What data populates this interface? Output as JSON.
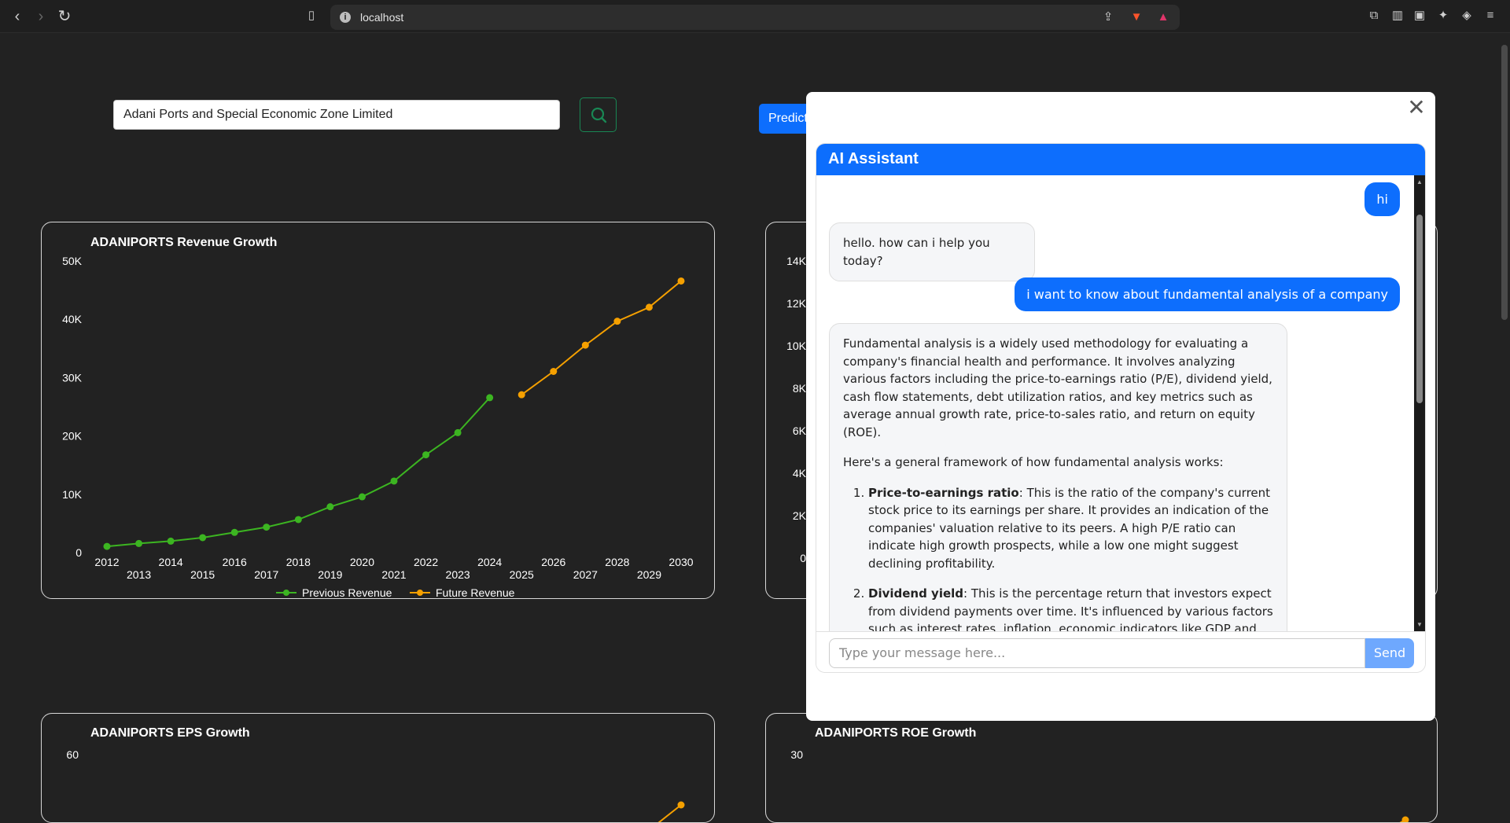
{
  "browser": {
    "url": "localhost",
    "icons": [
      "back-icon",
      "forward-icon",
      "reload-icon",
      "bookmark-icon",
      "site-info-icon",
      "share-icon",
      "brave-shields-icon",
      "rewards-icon",
      "extensions-icon",
      "sidebar-icon",
      "wallet-icon",
      "leo-icon",
      "vpn-icon",
      "menu-icon"
    ]
  },
  "search": {
    "value": "Adani Ports and Special Economic Zone Limited"
  },
  "predict_label": "Predict",
  "charts": {
    "revenue_title": "ADANIPORTS Revenue Growth",
    "eps_title": "ADANIPORTS EPS Growth",
    "roe_title": "ADANIPORTS ROE Growth",
    "second_chart_ticks": [
      "14K",
      "12K",
      "10K",
      "8K",
      "6K",
      "4K",
      "2K",
      "0"
    ]
  },
  "chart_data": [
    {
      "type": "line",
      "title": "ADANIPORTS Revenue Growth",
      "x": [
        2012,
        2013,
        2014,
        2015,
        2016,
        2017,
        2018,
        2019,
        2020,
        2021,
        2022,
        2023,
        2024,
        2025,
        2026,
        2027,
        2028,
        2029,
        2030
      ],
      "series": [
        {
          "name": "Previous Revenue",
          "color": "#3cb521",
          "x": [
            2012,
            2013,
            2014,
            2015,
            2016,
            2017,
            2018,
            2019,
            2020,
            2021,
            2022,
            2023,
            2024
          ],
          "values": [
            1200,
            1700,
            2100,
            2700,
            3600,
            4500,
            5800,
            8000,
            9700,
            12400,
            16900,
            20700,
            26700
          ]
        },
        {
          "name": "Future Revenue",
          "color": "#f5a000",
          "x": [
            2025,
            2026,
            2027,
            2028,
            2029,
            2030
          ],
          "values": [
            27200,
            31200,
            35700,
            39800,
            42200,
            46700
          ]
        }
      ],
      "y_ticks": [
        "0",
        "10K",
        "20K",
        "30K",
        "40K",
        "50K"
      ],
      "ylim": [
        0,
        50000
      ],
      "grid": false,
      "legend": "bottom"
    },
    {
      "type": "line",
      "title": "ADANIPORTS EPS Growth",
      "y_ticks": [
        "60"
      ]
    },
    {
      "type": "line",
      "title": "ADANIPORTS ROE Growth",
      "y_ticks": [
        "30"
      ]
    }
  ],
  "modal": {
    "close_icon": "close-icon",
    "chat_title": "AI Assistant",
    "messages": {
      "user1": "hi",
      "bot1": "hello. how can i help you today?",
      "user2": "i want to know about fundamental analysis of a company",
      "bot2_p1": "Fundamental analysis is a widely used methodology for evaluating a company's financial health and performance. It involves analyzing various factors including the price-to-earnings ratio (P/E), dividend yield, cash flow statements, debt utilization ratios, and key metrics such as average annual growth rate, price-to-sales ratio, and return on equity (ROE).",
      "bot2_p2": "Here's a general framework of how fundamental analysis works:",
      "bot2_item1_head": "Price-to-earnings ratio",
      "bot2_item1_body": ": This is the ratio of the company's current stock price to its earnings per share. It provides an indication of the companies' valuation relative to its peers. A high P/E ratio can indicate high growth prospects, while a low one might suggest declining profitability.",
      "bot2_item2_head": "Dividend yield",
      "bot2_item2_body": ": This is the percentage return that investors expect from dividend payments over time. It's influenced by various factors such as interest rates, inflation, economic indicators like GDP and inflation rate."
    },
    "input_placeholder": "Type your message here...",
    "send_label": "Send"
  }
}
